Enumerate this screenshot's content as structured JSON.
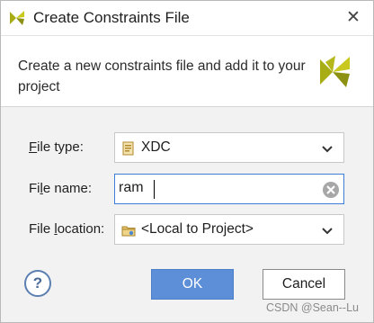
{
  "window": {
    "title": "Create Constraints File",
    "logo_icon": "vivado-logo-icon",
    "close_glyph": "✕"
  },
  "header": {
    "description": "Create a new constraints file and add it to your project",
    "logo_icon": "vivado-logo-icon"
  },
  "form": {
    "file_type": {
      "label_mnemonic": "F",
      "label_rest": "ile type:",
      "value": "XDC",
      "icon": "xdc-file-icon"
    },
    "file_name": {
      "label_pre": "Fi",
      "label_mnemonic": "l",
      "label_rest": "e name:",
      "value": "ram",
      "clear_icon": "clear-icon"
    },
    "file_location": {
      "label_pre": "File ",
      "label_mnemonic": "l",
      "label_rest": "ocation:",
      "value": "<Local to Project>",
      "icon": "folder-icon"
    }
  },
  "buttons": {
    "help": "?",
    "ok": "OK",
    "cancel": "Cancel"
  },
  "watermark": "CSDN @Sean--Lu",
  "colors": {
    "accent": "#5c8fd8",
    "focus_border": "#3d7fd8",
    "logo_green": "#9a9e14",
    "logo_yellow": "#c8c81e"
  }
}
